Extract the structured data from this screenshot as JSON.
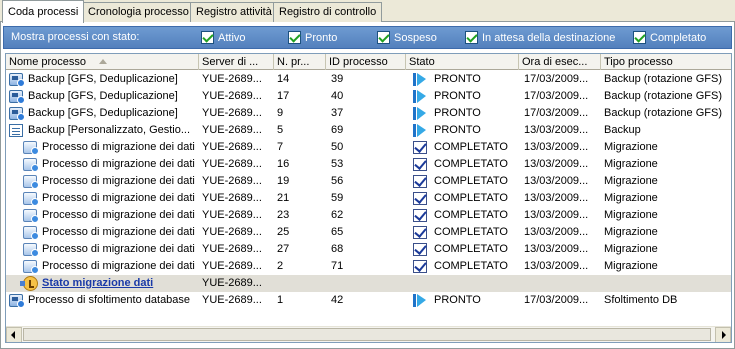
{
  "tabs": [
    {
      "label": "Coda processi"
    },
    {
      "label": "Cronologia processo"
    },
    {
      "label": "Registro attività"
    },
    {
      "label": "Registro di controllo"
    }
  ],
  "filter": {
    "label": "Mostra processi con stato:",
    "options": [
      {
        "label": "Attivo",
        "checked": true
      },
      {
        "label": "Pronto",
        "checked": true
      },
      {
        "label": "Sospeso",
        "checked": true
      },
      {
        "label": "In attesa della destinazione",
        "checked": true
      },
      {
        "label": "Completato",
        "checked": true
      }
    ]
  },
  "columns": [
    "Nome processo",
    "Server di ...",
    "N. pr...",
    "ID processo",
    "Stato",
    "Ora di esec...",
    "Tipo processo"
  ],
  "rows": [
    {
      "icon": "process-icon",
      "name": "Backup  [GFS, Deduplicazione]",
      "server": "YUE-2689...",
      "np": "14",
      "id": "39",
      "status_icon": "ready-icon",
      "status": "PRONTO",
      "time": "17/03/2009...",
      "type": "Backup (rotazione GFS)",
      "indent": 0
    },
    {
      "icon": "process-icon",
      "name": "Backup  [GFS, Deduplicazione]",
      "server": "YUE-2689...",
      "np": "17",
      "id": "40",
      "status_icon": "ready-icon",
      "status": "PRONTO",
      "time": "17/03/2009...",
      "type": "Backup (rotazione GFS)",
      "indent": 0
    },
    {
      "icon": "process-icon",
      "name": "Backup  [GFS, Deduplicazione]",
      "server": "YUE-2689...",
      "np": "9",
      "id": "37",
      "status_icon": "ready-icon",
      "status": "PRONTO",
      "time": "17/03/2009...",
      "type": "Backup (rotazione GFS)",
      "indent": 0
    },
    {
      "icon": "document-icon",
      "name": "Backup  [Personalizzato, Gestio...",
      "server": "YUE-2689...",
      "np": "5",
      "id": "69",
      "status_icon": "ready-icon",
      "status": "PRONTO",
      "time": "13/03/2009...",
      "type": "Backup",
      "indent": 0
    },
    {
      "icon": "migration-icon",
      "name": "Processo di migrazione dei dati",
      "server": "YUE-2689...",
      "np": "7",
      "id": "50",
      "status_icon": "completed-icon",
      "status": "COMPLETATO",
      "time": "13/03/2009...",
      "type": "Migrazione",
      "indent": 1
    },
    {
      "icon": "migration-icon",
      "name": "Processo di migrazione dei dati",
      "server": "YUE-2689...",
      "np": "16",
      "id": "53",
      "status_icon": "completed-icon",
      "status": "COMPLETATO",
      "time": "13/03/2009...",
      "type": "Migrazione",
      "indent": 1
    },
    {
      "icon": "migration-icon",
      "name": "Processo di migrazione dei dati",
      "server": "YUE-2689...",
      "np": "19",
      "id": "56",
      "status_icon": "completed-icon",
      "status": "COMPLETATO",
      "time": "13/03/2009...",
      "type": "Migrazione",
      "indent": 1
    },
    {
      "icon": "migration-icon",
      "name": "Processo di migrazione dei dati",
      "server": "YUE-2689...",
      "np": "21",
      "id": "59",
      "status_icon": "completed-icon",
      "status": "COMPLETATO",
      "time": "13/03/2009...",
      "type": "Migrazione",
      "indent": 1
    },
    {
      "icon": "migration-icon",
      "name": "Processo di migrazione dei dati",
      "server": "YUE-2689...",
      "np": "23",
      "id": "62",
      "status_icon": "completed-icon",
      "status": "COMPLETATO",
      "time": "13/03/2009...",
      "type": "Migrazione",
      "indent": 1
    },
    {
      "icon": "migration-icon",
      "name": "Processo di migrazione dei dati",
      "server": "YUE-2689...",
      "np": "25",
      "id": "65",
      "status_icon": "completed-icon",
      "status": "COMPLETATO",
      "time": "13/03/2009...",
      "type": "Migrazione",
      "indent": 1
    },
    {
      "icon": "migration-icon",
      "name": "Processo di migrazione dei dati",
      "server": "YUE-2689...",
      "np": "27",
      "id": "68",
      "status_icon": "completed-icon",
      "status": "COMPLETATO",
      "time": "13/03/2009...",
      "type": "Migrazione",
      "indent": 1
    },
    {
      "icon": "migration-icon",
      "name": "Processo di migrazione dei dati",
      "server": "YUE-2689...",
      "np": "2",
      "id": "71",
      "status_icon": "completed-icon",
      "status": "COMPLETATO",
      "time": "13/03/2009...",
      "type": "Migrazione",
      "indent": 1
    },
    {
      "icon": "status-icon",
      "name": "Stato migrazione dati",
      "server": "YUE-2689...",
      "np": "",
      "id": "",
      "status_icon": "",
      "status": "",
      "time": "",
      "type": "",
      "indent": 1,
      "selected": true,
      "link": true
    },
    {
      "icon": "process-icon",
      "name": "Processo di sfoltimento database",
      "server": "YUE-2689...",
      "np": "1",
      "id": "42",
      "status_icon": "ready-icon",
      "status": "PRONTO",
      "time": "17/03/2009...",
      "type": "Sfoltimento DB",
      "indent": 0
    }
  ],
  "colors": {
    "filter_bar": "#5b88c2",
    "selected_row": "#e1dfd7",
    "link": "#1a3aa8"
  }
}
